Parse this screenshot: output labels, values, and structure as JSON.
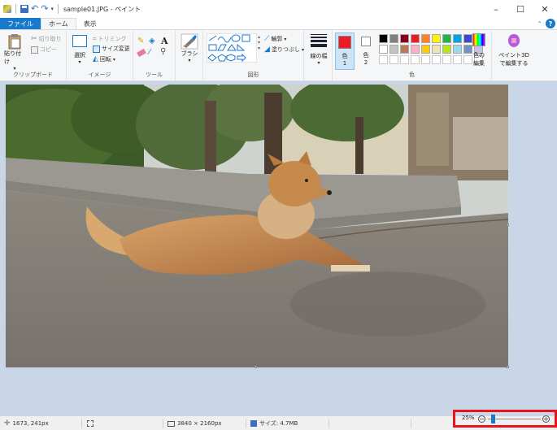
{
  "window": {
    "title": "sample01.JPG - ペイント",
    "minimize": "–",
    "maximize": "☐",
    "close": "✕"
  },
  "tabs": [
    {
      "label": "ファイル"
    },
    {
      "label": "ホーム"
    },
    {
      "label": "表示"
    }
  ],
  "ribbon": {
    "clipboard": {
      "paste": "貼り付け",
      "cut": "切り取り",
      "copy": "コピー",
      "group": "クリップボード"
    },
    "image": {
      "select": "選択",
      "crop": "トリミング",
      "resize": "サイズ変更",
      "rotate": "回転",
      "group": "イメージ"
    },
    "tools": {
      "text_tool": "A",
      "group": "ツール"
    },
    "brush": {
      "label": "ブラシ"
    },
    "shapes": {
      "outline": "輪郭",
      "fill": "塗りつぶし",
      "group": "図形"
    },
    "size": {
      "label": "線の幅"
    },
    "colors": {
      "color1_label": "色",
      "color1_num": "1",
      "color2_label": "色",
      "color2_num": "2",
      "edit_line1": "色の",
      "edit_line2": "編集",
      "group": "色",
      "color1_value": "#ed1c24",
      "color2_value": "#ffffff",
      "palette_row1": [
        "#000000",
        "#7f7f7f",
        "#880015",
        "#ed1c24",
        "#ff7f27",
        "#fff200",
        "#22b14c",
        "#00a2e8",
        "#3f48cc",
        "#a349a4"
      ],
      "palette_row2": [
        "#ffffff",
        "#c3c3c3",
        "#b97a57",
        "#ffaec9",
        "#ffc90e",
        "#efe4b0",
        "#b5e61d",
        "#99d9ea",
        "#7092be",
        "#c8bfe7"
      ],
      "palette_row3_count": 10
    },
    "paint3d": {
      "line1": "ペイント3D",
      "line2": "で編集する"
    }
  },
  "status": {
    "cursor_pos": "1673, 241px",
    "image_size": "3840 × 2160px",
    "file_size": "サイズ: 4.7MB",
    "zoom": "25%",
    "zoom_minus": "−",
    "zoom_plus": "+",
    "zoom_level_fraction": 0.09
  }
}
